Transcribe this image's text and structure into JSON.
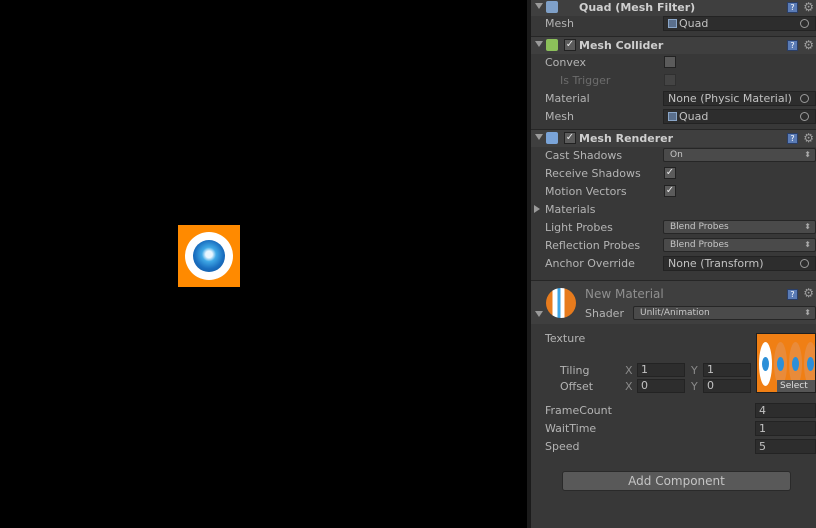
{
  "mesh_filter": {
    "title": "Quad (Mesh Filter)",
    "mesh_label": "Mesh",
    "mesh_value": "Quad"
  },
  "mesh_collider": {
    "title": "Mesh Collider",
    "enabled": "✓",
    "convex_label": "Convex",
    "is_trigger_label": "Is Trigger",
    "material_label": "Material",
    "material_value": "None (Physic Material)",
    "mesh_label": "Mesh",
    "mesh_value": "Quad"
  },
  "mesh_renderer": {
    "title": "Mesh Renderer",
    "enabled": "✓",
    "cast_shadows_label": "Cast Shadows",
    "cast_shadows_value": "On",
    "receive_shadows_label": "Receive Shadows",
    "receive_shadows_value": "✓",
    "motion_vectors_label": "Motion Vectors",
    "motion_vectors_value": "✓",
    "materials_label": "Materials",
    "light_probes_label": "Light Probes",
    "light_probes_value": "Blend Probes",
    "reflection_probes_label": "Reflection Probes",
    "reflection_probes_value": "Blend Probes",
    "anchor_override_label": "Anchor Override",
    "anchor_override_value": "None (Transform)"
  },
  "material": {
    "name": "New Material",
    "shader_label": "Shader",
    "shader_value": "Unlit/Animation",
    "texture_label": "Texture",
    "tiling_label": "Tiling",
    "tiling_x": "1",
    "tiling_y": "1",
    "offset_label": "Offset",
    "offset_x": "0",
    "offset_y": "0",
    "axis_x": "X",
    "axis_y": "Y",
    "select_label": "Select",
    "framecount_label": "FrameCount",
    "framecount_value": "4",
    "waittime_label": "WaitTime",
    "waittime_value": "1",
    "speed_label": "Speed",
    "speed_value": "5"
  },
  "add_component_label": "Add Component",
  "icons": {
    "help": "?",
    "gear": "⚙",
    "dropdown_arrow": "⬍"
  },
  "colors": {
    "sprite_orange": "#ff8a00",
    "sprite_blue": "#1a6fc0",
    "inspector_bg": "#383838"
  }
}
